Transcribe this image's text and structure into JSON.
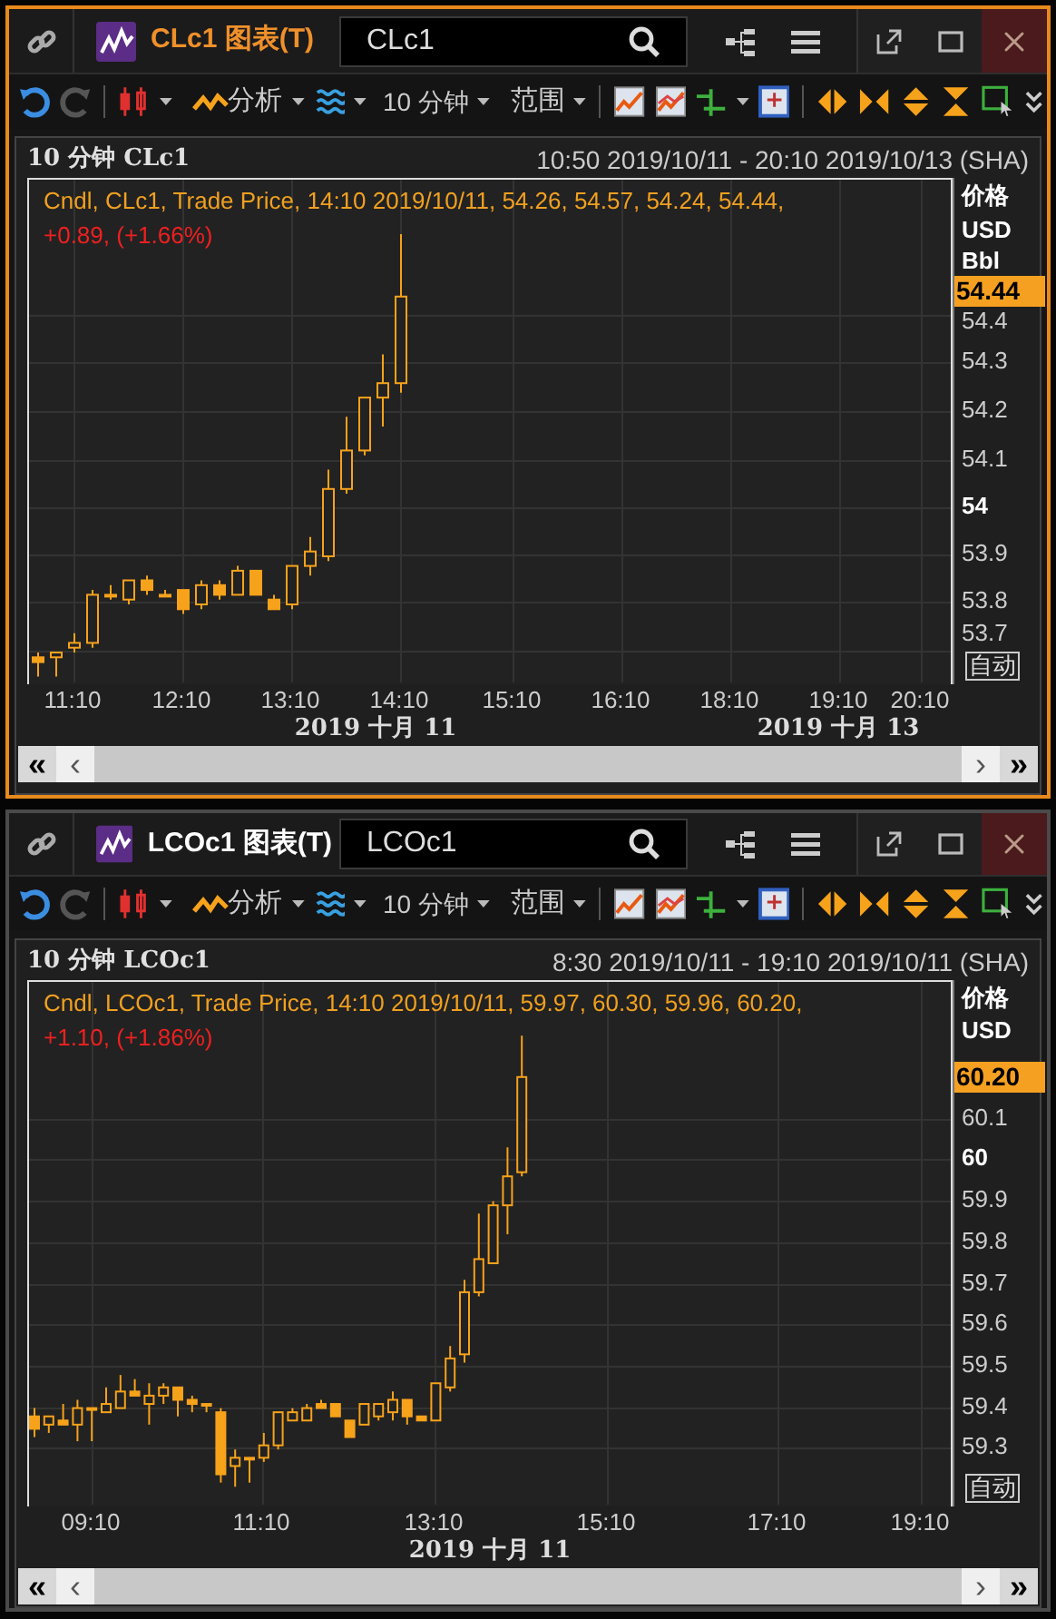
{
  "windows": [
    {
      "active": true,
      "title": "CLc1 图表(T)",
      "search": "CLc1",
      "toolbar": {
        "analysis": "分析",
        "interval": "10 分钟",
        "range": "范围"
      },
      "chart": {
        "heading": "10 分钟 CLc1",
        "period": "10:50 2019/10/11 - 20:10 2019/10/13 (SHA)",
        "legend": "Cndl, CLc1, Trade Price, 14:10 2019/10/11, 54.26, 54.57, 54.24, 54.44,",
        "change": "+0.89, (+1.66%)",
        "axis_labels": [
          "价格",
          "USD",
          "Bbl"
        ],
        "last_price": "54.44",
        "yticks": [
          {
            "label": "54.4",
            "bold": false
          },
          {
            "label": "54.3",
            "bold": false
          },
          {
            "label": "54.2",
            "bold": false
          },
          {
            "label": "54.1",
            "bold": false
          },
          {
            "label": "54",
            "bold": true
          },
          {
            "label": "53.9",
            "bold": false
          },
          {
            "label": "53.8",
            "bold": false
          },
          {
            "label": "53.7",
            "bold": false
          }
        ],
        "auto": "自动",
        "xticks": [
          "11:10",
          "12:10",
          "13:10",
          "14:10",
          "15:10",
          "16:10",
          "18:10",
          "19:10",
          "20:10"
        ],
        "dates": [
          "2019 十月 11",
          "2019 十月 13"
        ]
      },
      "scrollbar": {
        "first": "«",
        "prev": "‹",
        "next": "›",
        "last": "»"
      }
    },
    {
      "active": false,
      "title": "LCOc1 图表(T)",
      "search": "LCOc1",
      "toolbar": {
        "analysis": "分析",
        "interval": "10 分钟",
        "range": "范围"
      },
      "chart": {
        "heading": "10 分钟 LCOc1",
        "period": "8:30 2019/10/11 - 19:10 2019/10/11 (SHA)",
        "legend": "Cndl, LCOc1, Trade Price, 14:10 2019/10/11, 59.97, 60.30, 59.96, 60.20,",
        "change": "+1.10, (+1.86%)",
        "axis_labels": [
          "价格",
          "USD"
        ],
        "last_price": "60.20",
        "yticks": [
          {
            "label": "60.1",
            "bold": false
          },
          {
            "label": "60",
            "bold": true
          },
          {
            "label": "59.9",
            "bold": false
          },
          {
            "label": "59.8",
            "bold": false
          },
          {
            "label": "59.7",
            "bold": false
          },
          {
            "label": "59.6",
            "bold": false
          },
          {
            "label": "59.5",
            "bold": false
          },
          {
            "label": "59.4",
            "bold": false
          },
          {
            "label": "59.3",
            "bold": false
          }
        ],
        "auto": "自动",
        "xticks": [
          "09:10",
          "11:10",
          "13:10",
          "15:10",
          "17:10",
          "19:10"
        ],
        "dates": [
          "2019 十月 11"
        ]
      },
      "scrollbar": {
        "first": "«",
        "prev": "‹",
        "next": "›",
        "last": "»"
      }
    }
  ]
}
